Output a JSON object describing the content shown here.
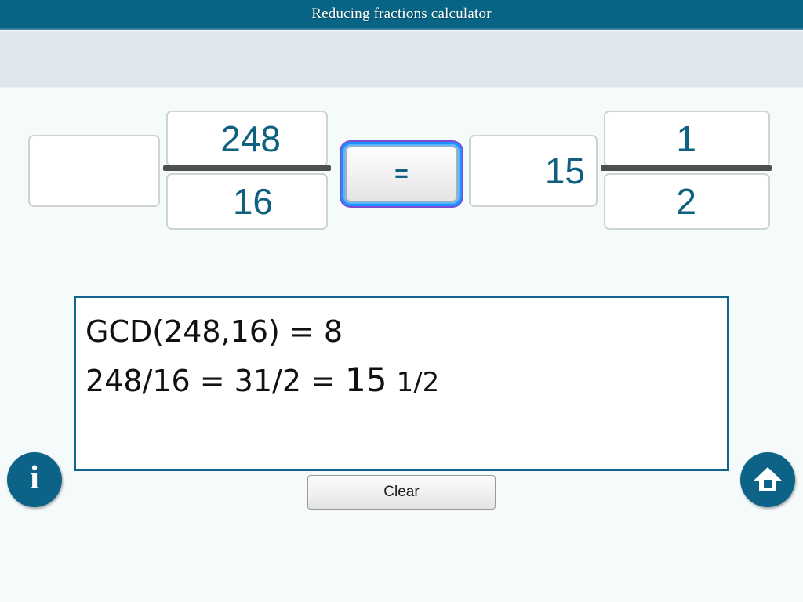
{
  "window": {
    "title": "Reducing fractions calculator"
  },
  "theme": {
    "header_bg": "#076484",
    "toolband_bg": "#dde7ec",
    "page_bg": "#f5fafb",
    "accent": "#10617f",
    "result_border": "#11648a",
    "fraction_bar": "#4f4f4f",
    "focus_ring": "#5fb4ff"
  },
  "expression": {
    "left": {
      "whole": "",
      "whole_placeholder": "",
      "numerator": "248",
      "denominator": "16"
    },
    "equals_label": "=",
    "right": {
      "whole": "15",
      "numerator": "1",
      "denominator": "2"
    }
  },
  "result": {
    "line1": "GCD(248,16) = 8",
    "line2": {
      "prefix": "248/16 = 31/2 = ",
      "whole": "15",
      "space": " ",
      "fraction": "1/2"
    }
  },
  "buttons": {
    "clear_label": "Clear",
    "info_glyph": "i"
  },
  "icons": {
    "info": "info-icon",
    "home": "home-icon"
  }
}
